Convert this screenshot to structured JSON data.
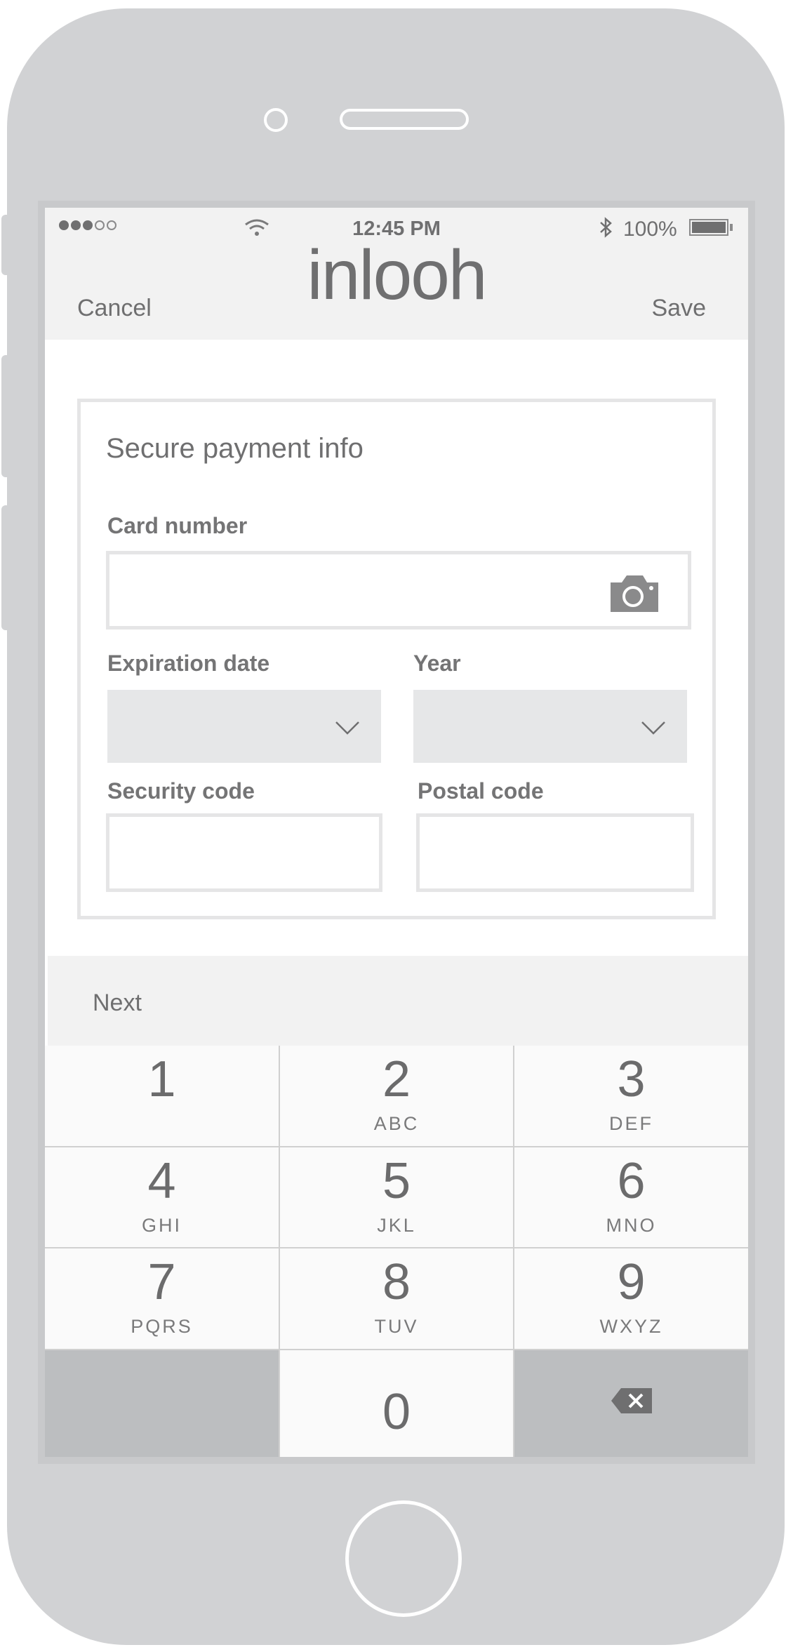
{
  "status_bar": {
    "time": "12:45 PM",
    "battery": "100%",
    "signal_icon": "signal-dots-icon",
    "wifi_icon": "wifi-icon",
    "bluetooth_glyph": "✱"
  },
  "nav": {
    "cancel_label": "Cancel",
    "save_label": "Save",
    "logo_text": "inlooh"
  },
  "form": {
    "title": "Secure payment info",
    "card_number_label": "Card number",
    "card_number_value": "",
    "expiration_label": "Expiration date",
    "expiration_value": "",
    "year_label": "Year",
    "year_value": "",
    "security_label": "Security code",
    "security_value": "",
    "postal_label": "Postal code",
    "postal_value": ""
  },
  "next_bar": {
    "label": "Next"
  },
  "keypad": {
    "keys": [
      {
        "num": "1",
        "letters": ""
      },
      {
        "num": "2",
        "letters": "ABC"
      },
      {
        "num": "3",
        "letters": "DEF"
      },
      {
        "num": "4",
        "letters": "GHI"
      },
      {
        "num": "5",
        "letters": "JKL"
      },
      {
        "num": "6",
        "letters": "MNO"
      },
      {
        "num": "7",
        "letters": "PQRS"
      },
      {
        "num": "8",
        "letters": "TUV"
      },
      {
        "num": "9",
        "letters": "WXYZ"
      },
      {
        "num": "0",
        "letters": ""
      }
    ],
    "delete_icon": "backspace-icon"
  },
  "colors": {
    "device_body": "#d1d2d4",
    "header_bg": "#f2f2f2",
    "text": "#6f6f70",
    "select_bg": "#e6e7e8",
    "key_bg": "#fafafa",
    "key_dark": "#bcbec0"
  }
}
